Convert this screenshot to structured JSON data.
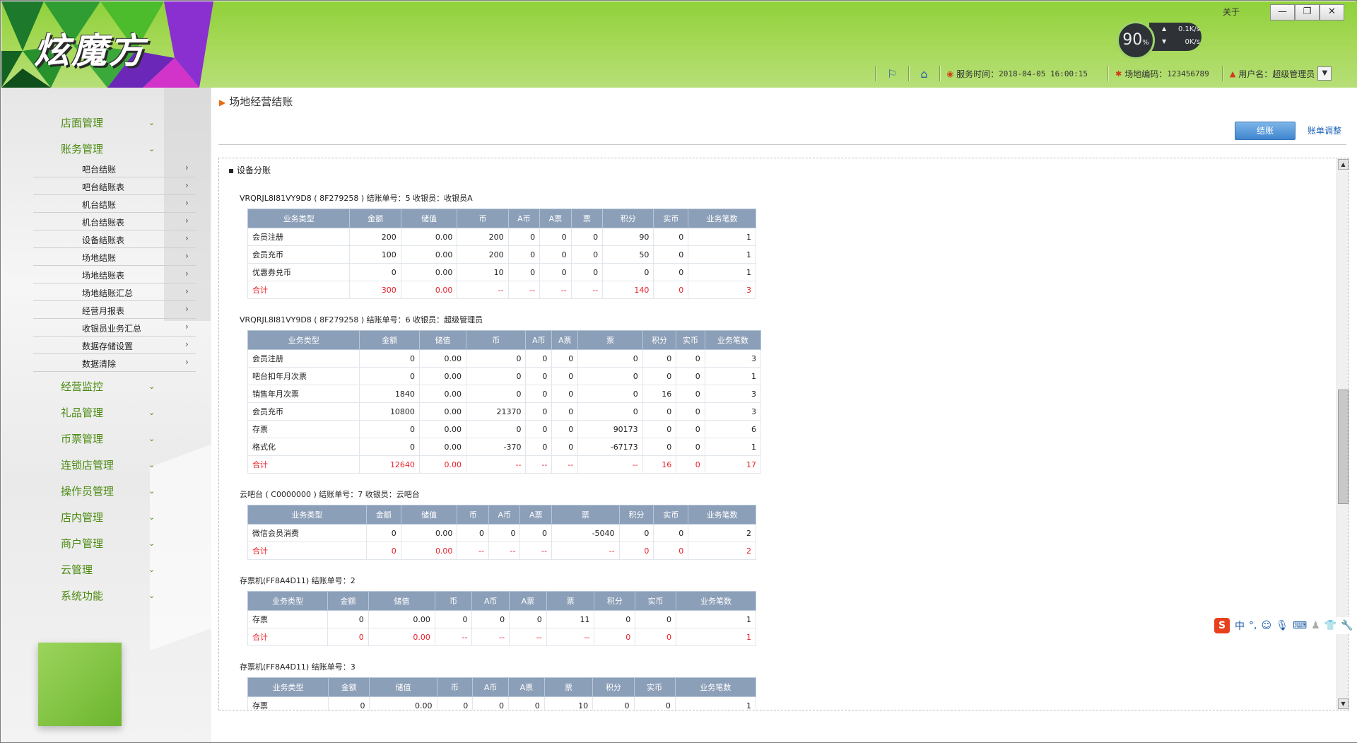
{
  "header": {
    "logo": "炫魔方",
    "about": "关于",
    "window_buttons": [
      "—",
      "❐",
      "✕"
    ],
    "net": {
      "percent": "90",
      "percent_unit": "%",
      "up": "0.1K/s",
      "down": "0K/s"
    },
    "service_time_label": "服务时间：",
    "service_time": "2018-04-05 16:00:15",
    "venue_code_label": "场地编码：",
    "venue_code": "123456789",
    "user_label": "用户名：",
    "user": "超级管理员"
  },
  "sidebar": {
    "menu": [
      {
        "label": "店面管理"
      },
      {
        "label": "账务管理"
      },
      {
        "label": "经营监控"
      },
      {
        "label": "礼品管理"
      },
      {
        "label": "币票管理"
      },
      {
        "label": "连锁店管理"
      },
      {
        "label": "操作员管理"
      },
      {
        "label": "店内管理"
      },
      {
        "label": "商户管理"
      },
      {
        "label": "云管理"
      },
      {
        "label": "系统功能"
      }
    ],
    "submenu": [
      {
        "label": "吧台结账"
      },
      {
        "label": "吧台结账表"
      },
      {
        "label": "机台结账"
      },
      {
        "label": "机台结账表"
      },
      {
        "label": "设备结账表"
      },
      {
        "label": "场地结账"
      },
      {
        "label": "场地结账表"
      },
      {
        "label": "场地结账汇总"
      },
      {
        "label": "经营月报表"
      },
      {
        "label": "收银员业务汇总"
      },
      {
        "label": "数据存储设置"
      },
      {
        "label": "数据清除"
      }
    ]
  },
  "main": {
    "title": "场地经营结账",
    "settle_button": "结账",
    "adjust_link": "账单调整",
    "section_title": "设备分账",
    "columns": [
      "业务类型",
      "金额",
      "储值",
      "币",
      "A币",
      "A票",
      "票",
      "积分",
      "实币",
      "业务笔数"
    ],
    "groups": [
      {
        "head": "VRQRJL8I81VY9D8 ( 8F279258 )   结账单号：5   收银员：收银员A",
        "rows": [
          [
            "会员注册",
            "200",
            "0.00",
            "200",
            "0",
            "0",
            "0",
            "90",
            "0",
            "1"
          ],
          [
            "会员充币",
            "100",
            "0.00",
            "200",
            "0",
            "0",
            "0",
            "50",
            "0",
            "1"
          ],
          [
            "优惠券兑币",
            "0",
            "0.00",
            "10",
            "0",
            "0",
            "0",
            "0",
            "0",
            "1"
          ]
        ],
        "total": [
          "合计",
          "300",
          "0.00",
          "--",
          "--",
          "--",
          "--",
          "140",
          "0",
          "3"
        ]
      },
      {
        "head": "VRQRJL8I81VY9D8 ( 8F279258 )   结账单号：6   收银员：超级管理员",
        "rows": [
          [
            "会员注册",
            "0",
            "0.00",
            "0",
            "0",
            "0",
            "0",
            "0",
            "0",
            "3"
          ],
          [
            "吧台扣年月次票",
            "0",
            "0.00",
            "0",
            "0",
            "0",
            "0",
            "0",
            "0",
            "1"
          ],
          [
            "销售年月次票",
            "1840",
            "0.00",
            "0",
            "0",
            "0",
            "0",
            "16",
            "0",
            "3"
          ],
          [
            "会员充币",
            "10800",
            "0.00",
            "21370",
            "0",
            "0",
            "0",
            "0",
            "0",
            "3"
          ],
          [
            "存票",
            "0",
            "0.00",
            "0",
            "0",
            "0",
            "90173",
            "0",
            "0",
            "6"
          ],
          [
            "格式化",
            "0",
            "0.00",
            "-370",
            "0",
            "0",
            "-67173",
            "0",
            "0",
            "1"
          ]
        ],
        "total": [
          "合计",
          "12640",
          "0.00",
          "--",
          "--",
          "--",
          "--",
          "16",
          "0",
          "17"
        ]
      },
      {
        "head": "云吧台 ( C0000000 )   结账单号：7   收银员：云吧台",
        "rows": [
          [
            "微信会员消费",
            "0",
            "0.00",
            "0",
            "0",
            "0",
            "-5040",
            "0",
            "0",
            "2"
          ]
        ],
        "total": [
          "合计",
          "0",
          "0.00",
          "--",
          "--",
          "--",
          "--",
          "0",
          "0",
          "2"
        ]
      },
      {
        "head": "存票机(FF8A4D11)   结账单号：2",
        "rows": [
          [
            "存票",
            "0",
            "0.00",
            "0",
            "0",
            "0",
            "11",
            "0",
            "0",
            "1"
          ]
        ],
        "total": [
          "合计",
          "0",
          "0.00",
          "--",
          "--",
          "--",
          "--",
          "0",
          "0",
          "1"
        ]
      },
      {
        "head": "存票机(FF8A4D11)   结账单号：3",
        "rows": [
          [
            "存票",
            "0",
            "0.00",
            "0",
            "0",
            "0",
            "10",
            "0",
            "0",
            "1"
          ]
        ],
        "total": null
      }
    ]
  },
  "ime": {
    "logo": "S",
    "mode": "中"
  }
}
